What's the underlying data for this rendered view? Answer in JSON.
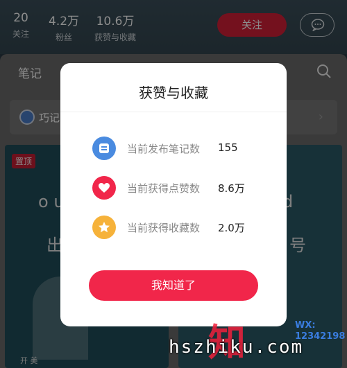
{
  "profile": {
    "stats": [
      {
        "num": "20",
        "label": "关注"
      },
      {
        "num": "4.2万",
        "label": "粉丝"
      },
      {
        "num": "10.6万",
        "label": "获赞与收藏"
      }
    ],
    "follow_label": "关注",
    "message_icon": "chat-bubble-icon"
  },
  "background": {
    "tab_notes": "笔记",
    "collection_label": "巧记",
    "pinned_badge": "置顶",
    "card_caption": "开 美",
    "card_text": [
      "o u",
      "出"
    ],
    "card2_text": [
      "d",
      "号"
    ]
  },
  "modal": {
    "title": "获赞与收藏",
    "rows": [
      {
        "icon": "note-icon",
        "label": "当前发布笔记数",
        "value": "155",
        "color": "#4a8be0"
      },
      {
        "icon": "heart-icon",
        "label": "当前获得点赞数",
        "value": "8.6万",
        "color": "#f1264a"
      },
      {
        "icon": "star-icon",
        "label": "当前获得收藏数",
        "value": "2.0万",
        "color": "#f6b23a"
      }
    ],
    "confirm_label": "我知道了"
  },
  "watermark": {
    "site": "hszhiku.com",
    "wx": "WX:",
    "wx_num": "12342198"
  }
}
